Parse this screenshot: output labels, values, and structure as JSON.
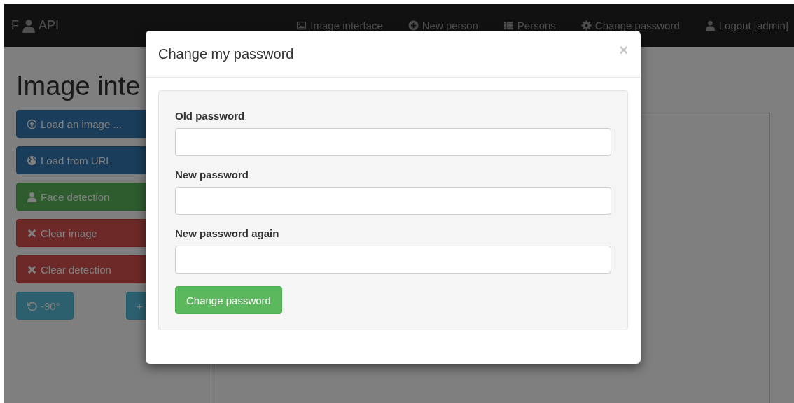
{
  "navbar": {
    "brand_prefix": "F",
    "brand_suffix": "API",
    "items": [
      {
        "label": "Image interface"
      },
      {
        "label": "New person"
      },
      {
        "label": "Persons"
      },
      {
        "label": "Change password"
      },
      {
        "label": "Logout [admin]"
      }
    ]
  },
  "page": {
    "heading": "Image inte",
    "buttons": [
      {
        "label": "Load an image ...",
        "kind": "primary"
      },
      {
        "label": "Load from URL",
        "kind": "primary"
      },
      {
        "label": "Face detection",
        "kind": "success"
      },
      {
        "label": "Clear image",
        "kind": "danger"
      },
      {
        "label": "Clear detection",
        "kind": "danger"
      }
    ],
    "rotate_buttons": [
      {
        "label": "-90°",
        "kind": "info"
      },
      {
        "label": "+",
        "kind": "info"
      }
    ]
  },
  "modal": {
    "title": "Change my password",
    "close": "×",
    "fields": [
      {
        "label": "Old password"
      },
      {
        "label": "New password"
      },
      {
        "label": "New password again"
      }
    ],
    "submit": "Change password"
  }
}
